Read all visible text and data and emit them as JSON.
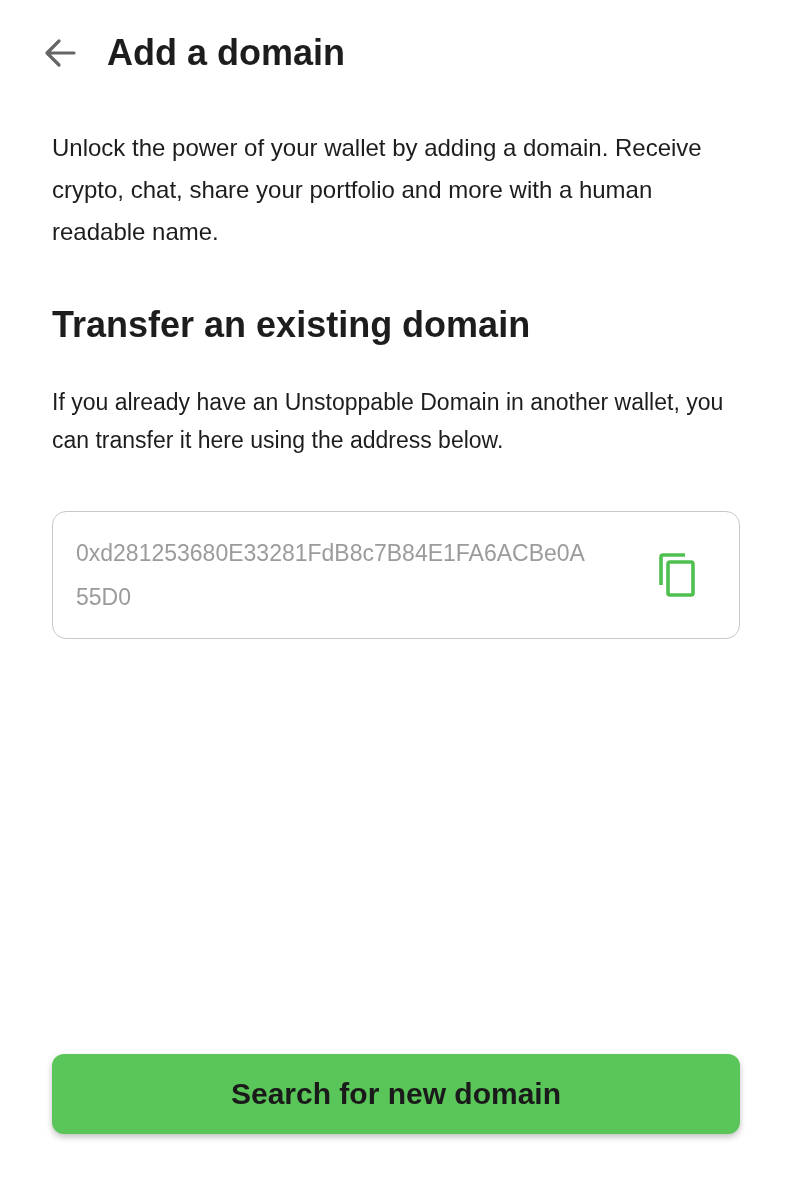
{
  "header": {
    "title": "Add a domain"
  },
  "intro": "Unlock the power of your wallet by adding a domain. Receive crypto, chat, share your portfolio and more with a human readable name.",
  "section": {
    "title": "Transfer an existing domain",
    "description": "If you already have an Unstoppable Domain in another wallet, you can transfer it here using the address below."
  },
  "address_field": {
    "value": "0xd281253680E33281FdB8c7B84E1FA6ACBe0A55D0"
  },
  "primary_button": {
    "label": "Search for new domain"
  }
}
